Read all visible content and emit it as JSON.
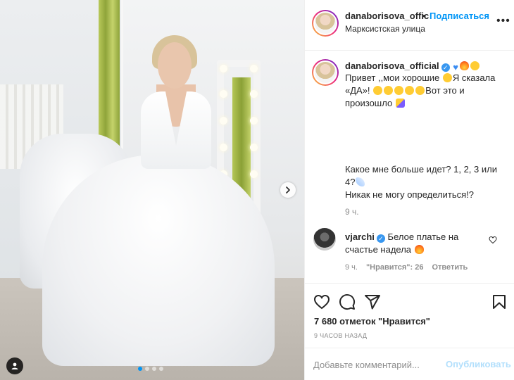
{
  "header": {
    "username": "danaborisova_offic",
    "separator": "•",
    "follow_label": "Подписаться",
    "location": "Марксистская улица",
    "more_label": "•••"
  },
  "caption": {
    "username": "danaborisova_official",
    "line1": "Привет ,,мои хорошие ",
    "line1b": "Я сказала",
    "line2a": "«ДА»! ",
    "line2b": "Вот это и",
    "line3": "произошло ",
    "question_line1": "Какое мне больше идет? 1, 2, 3 или",
    "question_line2": "4?",
    "question_line3": "Никак не могу определиться!?",
    "time": "9 ч."
  },
  "comment": {
    "username": "vjarchi",
    "text_line1": "Белое платье на",
    "text_line2": "счастье надела ",
    "time": "9 ч.",
    "likes_label": "\"Нравится\": 26",
    "reply_label": "Ответить"
  },
  "post": {
    "likes": "7 680 отметок \"Нравится\"",
    "age": "9 часов назад",
    "carousel": {
      "total": 4,
      "current": 1
    }
  },
  "composer": {
    "placeholder": "Добавьте комментарий...",
    "publish_label": "Опубликовать"
  },
  "icons": {
    "verified": "verified-badge-icon",
    "like": "heart-icon",
    "comment": "comment-icon",
    "share": "paper-plane-icon",
    "save": "bookmark-icon",
    "next": "chevron-right-icon",
    "tags": "user-tag-icon"
  },
  "colors": {
    "link": "#0095f6",
    "publish_disabled": "#b2dffc",
    "muted": "#8e8e8e",
    "text": "#262626",
    "verified": "#3897f0"
  }
}
